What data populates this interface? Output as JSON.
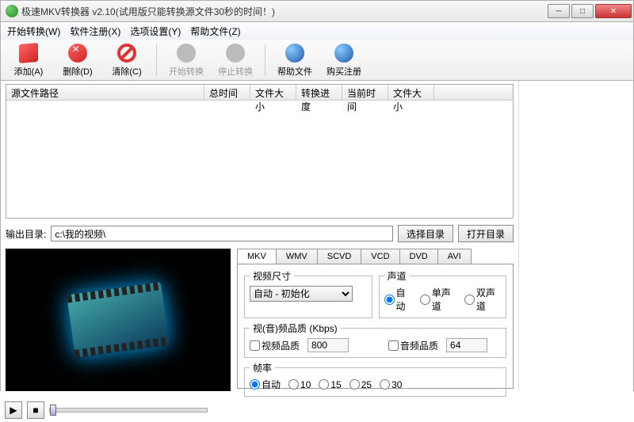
{
  "window": {
    "title": "极速MKV转换器 v2.10(试用版只能转换源文件30秒的时间！)"
  },
  "menu": {
    "start": "开始转换(W)",
    "register": "软件注册(X)",
    "options": "选项设置(Y)",
    "help": "帮助文件(Z)"
  },
  "toolbar": {
    "add": "添加(A)",
    "delete": "删除(D)",
    "clear": "清除(C)",
    "start": "开始转换",
    "stop": "停止转换",
    "help": "帮助文件",
    "buy": "购买注册"
  },
  "columns": {
    "path": "源文件路径",
    "total_time": "总时间",
    "file_size": "文件大小",
    "progress": "转换进度",
    "current_time": "当前时间",
    "file_size2": "文件大小"
  },
  "output": {
    "label": "输出目录:",
    "value": "c:\\我的视频\\",
    "choose": "选择目录",
    "open": "打开目录"
  },
  "tabs": [
    "MKV",
    "WMV",
    "SCVD",
    "VCD",
    "DVD",
    "AVI"
  ],
  "settings": {
    "video_size_legend": "视频尺寸",
    "video_size_value": "自动 - 初始化",
    "audio_channel_legend": "声道",
    "ch_auto": "自动",
    "ch_mono": "单声道",
    "ch_stereo": "双声道",
    "quality_legend": "视(音)频品质 (Kbps)",
    "video_quality": "视频品质",
    "audio_quality": "音频品质",
    "vq_value": "800",
    "aq_value": "64",
    "framerate_legend": "帧率",
    "fr_auto": "自动",
    "fr_10": "10",
    "fr_15": "15",
    "fr_25": "25",
    "fr_30": "30"
  }
}
